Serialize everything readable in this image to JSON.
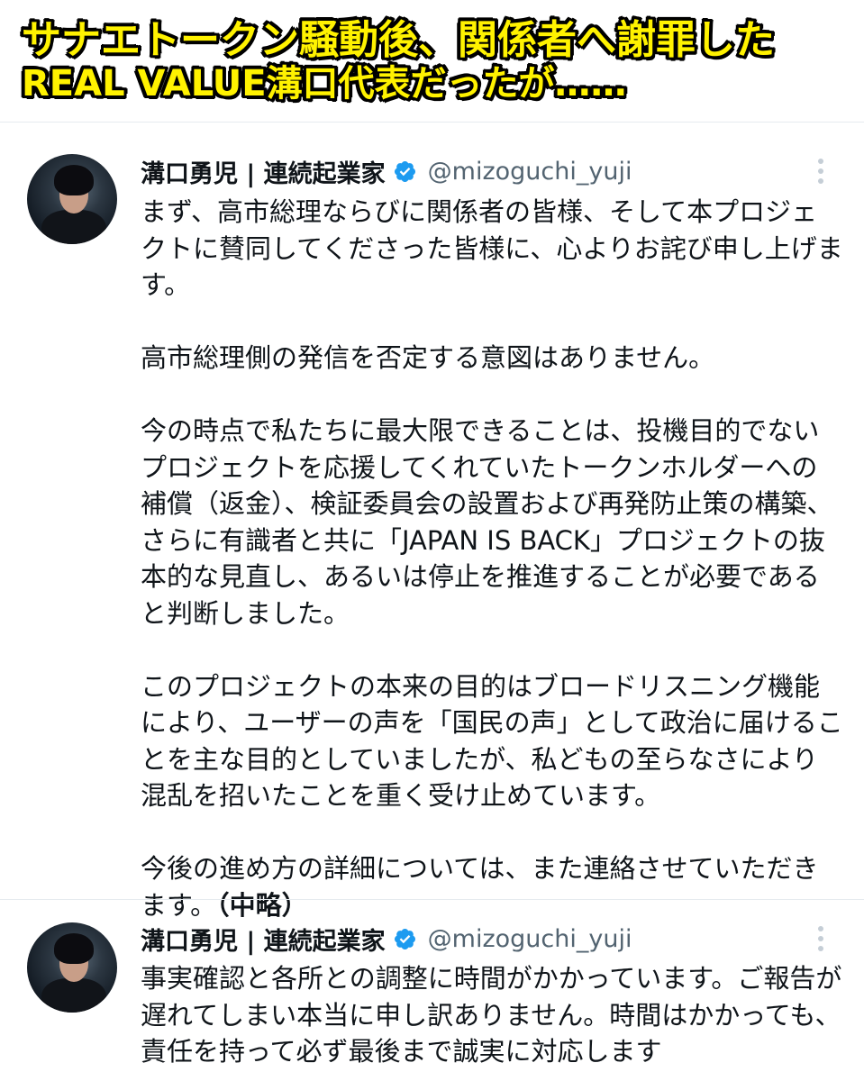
{
  "caption": {
    "line1": "サナエトークン騒動後、関係者へ謝罪した",
    "line2": "REAL VALUE溝口代表だったが……"
  },
  "colors": {
    "caption_fill": "#fff200",
    "caption_stroke": "#000000",
    "verified_badge": "#1d9bf0",
    "handle_gray": "#536471",
    "divider": "#e6ebef"
  },
  "tweets": [
    {
      "display_name": "溝口勇児 | 連続起業家",
      "handle": "@mizoguchi_yuji",
      "verified_icon": "verified-badge-icon",
      "more_icon": "vertical-dots-icon",
      "paragraphs": [
        "まず、高市総理ならびに関係者の皆様、そして本プロジェクトに賛同してくださった皆様に、心よりお詫び申し上げます。",
        "高市総理側の発信を否定する意図はありません。",
        "今の時点で私たちに最大限できることは、投機目的でないプロジェクトを応援してくれていたトークンホルダーへの補償（返金）、検証委員会の設置および再発防止策の構築、さらに有識者と共に「JAPAN IS BACK」プロジェクトの抜本的な見直し、あるいは停止を推進することが必要であると判断しました。",
        "このプロジェクトの本来の目的はブロードリスニング機能により、ユーザーの声を「国民の声」として政治に届けることを主な目的としていましたが、私どもの至らなさにより混乱を招いたことを重く受け止めています。",
        "今後の進め方の詳細については、また連絡させていただきます。"
      ],
      "annotation": "（中略）"
    },
    {
      "display_name": "溝口勇児 | 連続起業家",
      "handle": "@mizoguchi_yuji",
      "verified_icon": "verified-badge-icon",
      "more_icon": "vertical-dots-icon",
      "paragraphs": [
        "事実確認と各所との調整に時間がかかっています。ご報告が遅れてしまい本当に申し訳ありません。時間はかかっても、責任を持って必ず最後まで誠実に対応します"
      ]
    }
  ]
}
